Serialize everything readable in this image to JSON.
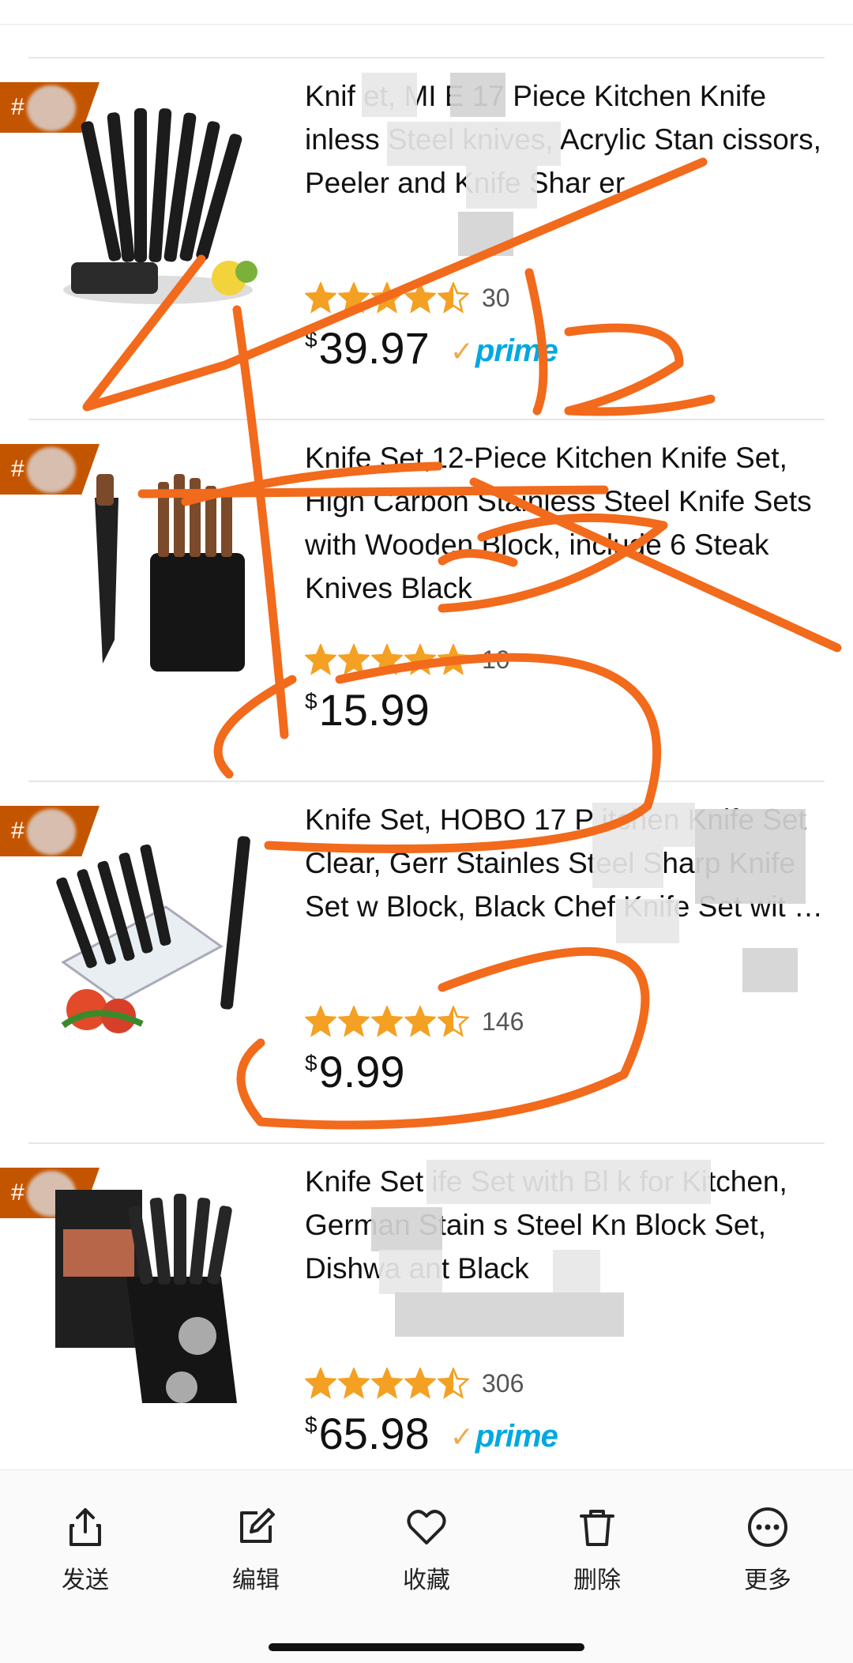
{
  "colors": {
    "rank_badge": "#c45500",
    "star": "#f4a023",
    "prime_check": "#f3a847",
    "prime_text": "#00a8e1",
    "annotation_ink": "#f26a1b"
  },
  "products": [
    {
      "rank": "#",
      "title": "Knif  et, MI  E 17 Piece Kitchen Knife  inless Steel knives, Acrylic Stan  cissors, Peeler and Knife Shar  er",
      "rating": 4.5,
      "reviews": "30",
      "currency": "$",
      "price": "39.97",
      "prime": true,
      "prime_label": "prime",
      "image_icon": "knife-set-acrylic-stand-icon"
    },
    {
      "rank": "#",
      "title": "Knife Set,12-Piece Kitchen Knife Set, High Carbon Stainless Steel Knife Sets with Wooden Block, include 6 Steak Knives Black",
      "rating": 5,
      "reviews": "10",
      "currency": "$",
      "price": "15.99",
      "prime": false,
      "image_icon": "knife-block-wood-handles-icon"
    },
    {
      "rank": "#",
      "title": "Knife Set, HOBO 17 P  itchen Knife Set Clear, Gerr  Stainles Steel Sharp Knife Set w  Block, Black Chef Knife Set wit  …",
      "rating": 4.5,
      "reviews": "146",
      "currency": "$",
      "price": "9.99",
      "prime": false,
      "image_icon": "knife-set-clear-block-icon"
    },
    {
      "rank": "#",
      "title": "Knife Set  ife Set with Bl  k for Kitchen, German Stain  s Steel Kn  Block Set, Dishwa  ant Black",
      "rating": 4.5,
      "reviews": "306",
      "currency": "$",
      "price": "65.98",
      "prime": true,
      "prime_label": "prime",
      "image_icon": "knife-block-black-box-icon"
    }
  ],
  "toolbar": [
    {
      "label": "发送",
      "icon": "share-icon"
    },
    {
      "label": "编辑",
      "icon": "edit-icon"
    },
    {
      "label": "收藏",
      "icon": "heart-icon"
    },
    {
      "label": "删除",
      "icon": "trash-icon"
    },
    {
      "label": "更多",
      "icon": "more-icon"
    }
  ]
}
